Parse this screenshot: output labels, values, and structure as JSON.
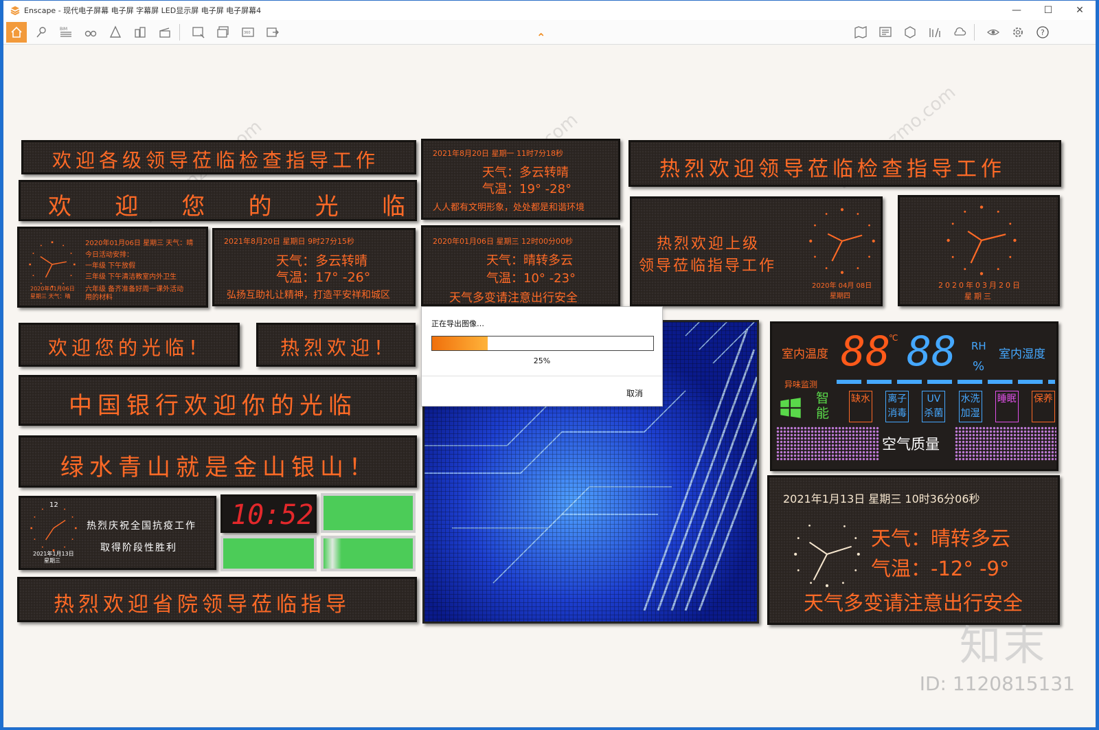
{
  "window": {
    "title": "Enscape - 现代电子屏幕 电子屏 字幕屏 LED显示屏 电子屏 电子屏幕4",
    "minimize": "—",
    "maximize": "☐",
    "close": "✕"
  },
  "toolbar": {
    "icons": [
      "home-icon",
      "location-icon",
      "bim-icon",
      "binoculars-icon",
      "perspective-icon",
      "buildings-icon",
      "clapper-icon",
      "screenshot-icon",
      "batch-render-icon",
      "panorama-icon",
      "export-icon",
      "map-icon",
      "views-icon",
      "asset-icon",
      "library-icon",
      "settings-cloud-icon",
      "eye-icon",
      "gear-icon",
      "help-icon"
    ],
    "bim_label": "BIM",
    "help_label": "?"
  },
  "panels": {
    "p1": "欢迎各级领导莅临检查指导工作",
    "p2": [
      "欢",
      "迎",
      "您",
      "的",
      "光",
      "临"
    ],
    "p3": {
      "line1": "2020年01月06日  星期三 天气：晴",
      "line2": "今日活动安排：",
      "line3": "一年级 下午放假",
      "line4": "三年级 下午清洁教室内外卫生",
      "line5": "六年级 备齐准备好周一课外活动",
      "line6": "用的材料",
      "clock_date": "2020年01月06日",
      "clock_day": "星期三 天气：晴"
    },
    "p4": {
      "datetime": "2021年8月20日  星期日 9时27分15秒",
      "weather": "天气：多云转晴",
      "temp": "气温：17° -26°",
      "slogan": "弘扬互助礼让精神，打造平安祥和城区"
    },
    "p5": {
      "datetime": "2021年8月20日  星期一 11时7分18秒",
      "weather": "天气：多云转晴",
      "temp": "气温：19° -28°",
      "slogan": "人人都有文明形象，处处都是和谐环境"
    },
    "p6": {
      "datetime": "2020年01月06日  星期三 12时00分00秒",
      "weather": "天气：晴转多云",
      "temp": "气温：10° -23°",
      "slogan": "天气多变请注意出行安全"
    },
    "p7": "热烈欢迎领导莅临检查指导工作",
    "p8": {
      "line1": "热烈欢迎上级",
      "line2": "领导莅临指导工作",
      "date": "2020年 04月 08日",
      "day": "星期四"
    },
    "p9": {
      "date": "2020年03月20日",
      "day": "星期三"
    },
    "p10": "欢迎您的光临！",
    "p11": "热烈欢迎！",
    "p12": "中国银行欢迎你的光临",
    "p13": "绿水青山就是金山银山！",
    "p14": {
      "line1": "热烈庆祝全国抗疫工作",
      "line2": "取得阶段性胜利",
      "clock_12": "12",
      "date": "2021年1月13日",
      "day": "星期三"
    },
    "p15": "10:52",
    "p16": "热烈欢迎省院领导莅临指导",
    "p17": {
      "temp_label": "室内温度",
      "temp_value": "88",
      "temp_unit": "℃",
      "hum_value": "88",
      "hum_unit": "RH",
      "hum_pct": "%",
      "hum_label": "室内湿度",
      "odor": "异味监测",
      "smart": "智能",
      "items": [
        {
          "label": "缺水",
          "color": "#ff6a26"
        },
        {
          "label": "离子消毒",
          "color": "#45a8ff"
        },
        {
          "label": "UV杀菌",
          "color": "#45a8ff"
        },
        {
          "label": "水洗加湿",
          "color": "#45a8ff"
        },
        {
          "label": "睡眠",
          "color": "#e050e8"
        },
        {
          "label": "保养",
          "color": "#ff6a26"
        }
      ],
      "air": "空气质量"
    },
    "p18": {
      "datetime": "2021年1月13日  星期三 10时36分06秒",
      "weather": "天气：晴转多云",
      "temp": "气温：-12° -9°",
      "slogan": "天气多变请注意出行安全"
    }
  },
  "dialog": {
    "title": "正在导出图像…",
    "progress_percent": 25,
    "percent_label": "25%",
    "cancel": "取消"
  },
  "watermark": {
    "site": "www.znzmo.com",
    "brand": "知末",
    "id": "ID: 1120815131"
  },
  "colors": {
    "led_orange": "#ff6a26",
    "led_blue": "#45a8ff",
    "panel_bg": "#2a2421",
    "accent": "#f29a3b"
  }
}
